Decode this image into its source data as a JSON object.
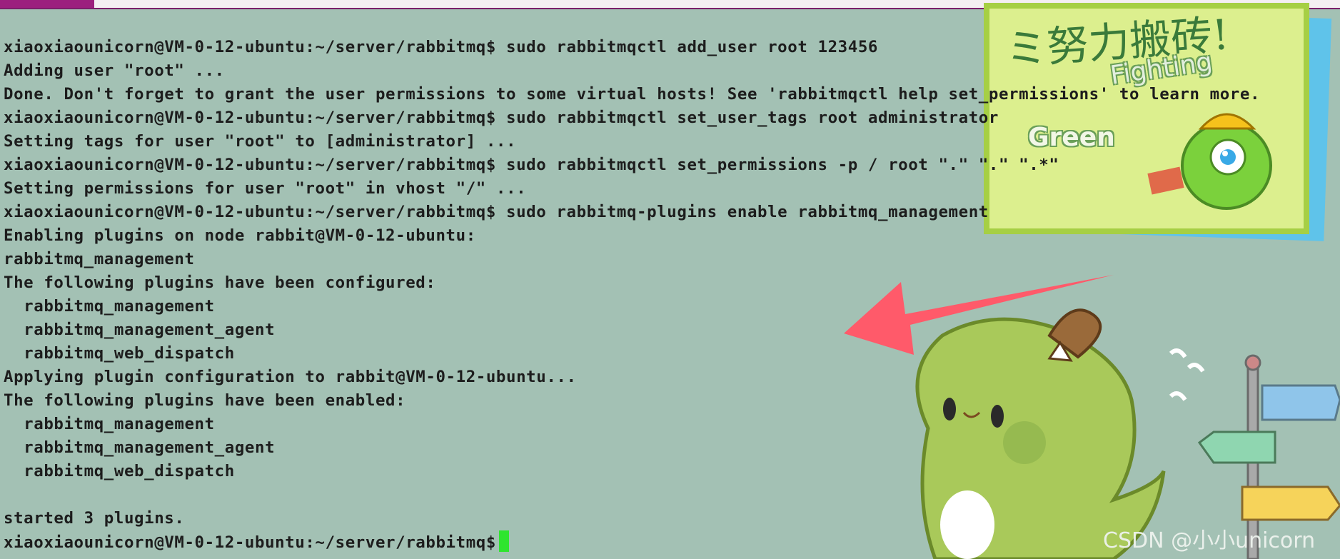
{
  "tab": {
    "label": ""
  },
  "terminal": {
    "prompt": "xiaoxiaounicorn@VM-0-12-ubuntu:~/server/rabbitmq$",
    "lines": [
      "xiaoxiaounicorn@VM-0-12-ubuntu:~/server/rabbitmq$ sudo rabbitmqctl add_user root 123456",
      "Adding user \"root\" ...",
      "Done. Don't forget to grant the user permissions to some virtual hosts! See 'rabbitmqctl help set_permissions' to learn more.",
      "xiaoxiaounicorn@VM-0-12-ubuntu:~/server/rabbitmq$ sudo rabbitmqctl set_user_tags root administrator",
      "Setting tags for user \"root\" to [administrator] ...",
      "xiaoxiaounicorn@VM-0-12-ubuntu:~/server/rabbitmq$ sudo rabbitmqctl set_permissions -p / root \".\" \".\" \".*\"",
      "Setting permissions for user \"root\" in vhost \"/\" ...",
      "xiaoxiaounicorn@VM-0-12-ubuntu:~/server/rabbitmq$ sudo rabbitmq-plugins enable rabbitmq_management",
      "Enabling plugins on node rabbit@VM-0-12-ubuntu:",
      "rabbitmq_management",
      "The following plugins have been configured:",
      "  rabbitmq_management",
      "  rabbitmq_management_agent",
      "  rabbitmq_web_dispatch",
      "Applying plugin configuration to rabbit@VM-0-12-ubuntu...",
      "The following plugins have been enabled:",
      "  rabbitmq_management",
      "  rabbitmq_management_agent",
      "  rabbitmq_web_dispatch",
      "",
      "started 3 plugins."
    ]
  },
  "wallpaper": {
    "sticky_text": "ミ努力搬砖!",
    "fighting_text": "Fighting",
    "green_text": "Green",
    "watermark": "CSDN @小小unicorn"
  },
  "colors": {
    "background": "#a3c1b4",
    "text": "#1d1d1d",
    "cursor": "#2ee52e",
    "arrow": "#ff5a6a",
    "sticky_note": "#dcef8e",
    "dino": "#a9c95a",
    "tab": "#9c1f7e"
  },
  "icons": [
    "cursor-block",
    "pointer-arrow",
    "dinosaur-illustration",
    "sticky-note",
    "signpost"
  ]
}
